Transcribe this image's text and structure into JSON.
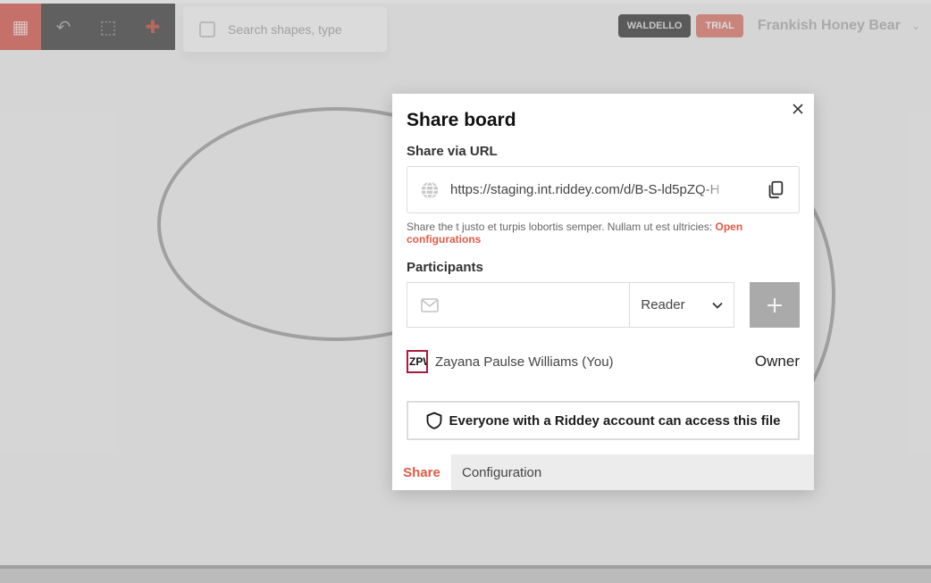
{
  "background": {
    "search_placeholder": "Search shapes, type",
    "badge_dark": "WALDELLO",
    "badge_red": "TRIAL",
    "user_name": "Frankish Honey Bear"
  },
  "modal": {
    "title": "Share board",
    "share_via_url_label": "Share via URL",
    "url_value": "https://staging.int.riddey.com/d/B-S-ld5pZQ-H",
    "help_text": "Share the t justo et turpis lobortis semper. Nullam ut est ultricies: ",
    "help_link": "Open configurations",
    "participants_label": "Participants",
    "email_placeholder": "",
    "role_selected": "Reader",
    "members": [
      {
        "initials": "ZPW",
        "name": "Zayana Paulse Williams (You)",
        "role": "Owner"
      }
    ],
    "access_text": "Everyone with a Riddey account can access this file",
    "tabs": [
      {
        "label": "Share",
        "active": true
      },
      {
        "label": "Configuration",
        "active": false
      }
    ]
  },
  "colors": {
    "accent": "#e05a46",
    "avatar_border": "#a61c3c",
    "add_button": "#aaaaaa"
  }
}
